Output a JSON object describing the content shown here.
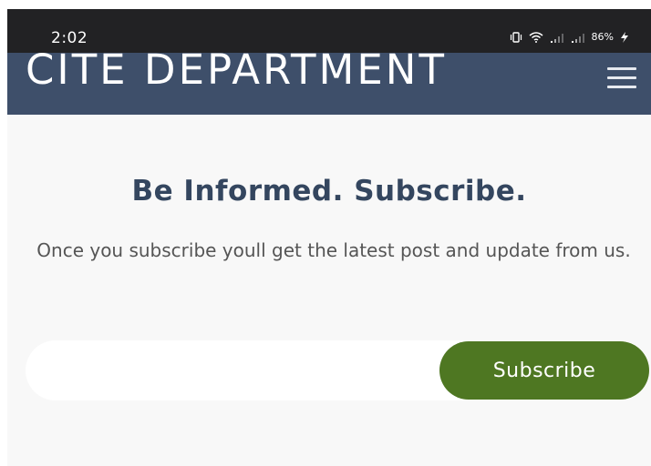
{
  "status_bar": {
    "time": "2:02",
    "battery": "86%",
    "icons": [
      "vibrate-icon",
      "wifi-icon",
      "signal-icon",
      "signal-icon",
      "battery-charging-icon"
    ]
  },
  "header": {
    "title": "CITE DEPARTMENT",
    "menu_icon": "hamburger-menu-icon",
    "background": "#3e4f6a"
  },
  "subscribe": {
    "heading": "Be Informed. Subscribe.",
    "description": "Once you subscribe youll get the latest post and update from us.",
    "email_value": "",
    "email_placeholder": "",
    "button_label": "Subscribe",
    "button_color": "#4e7722"
  }
}
